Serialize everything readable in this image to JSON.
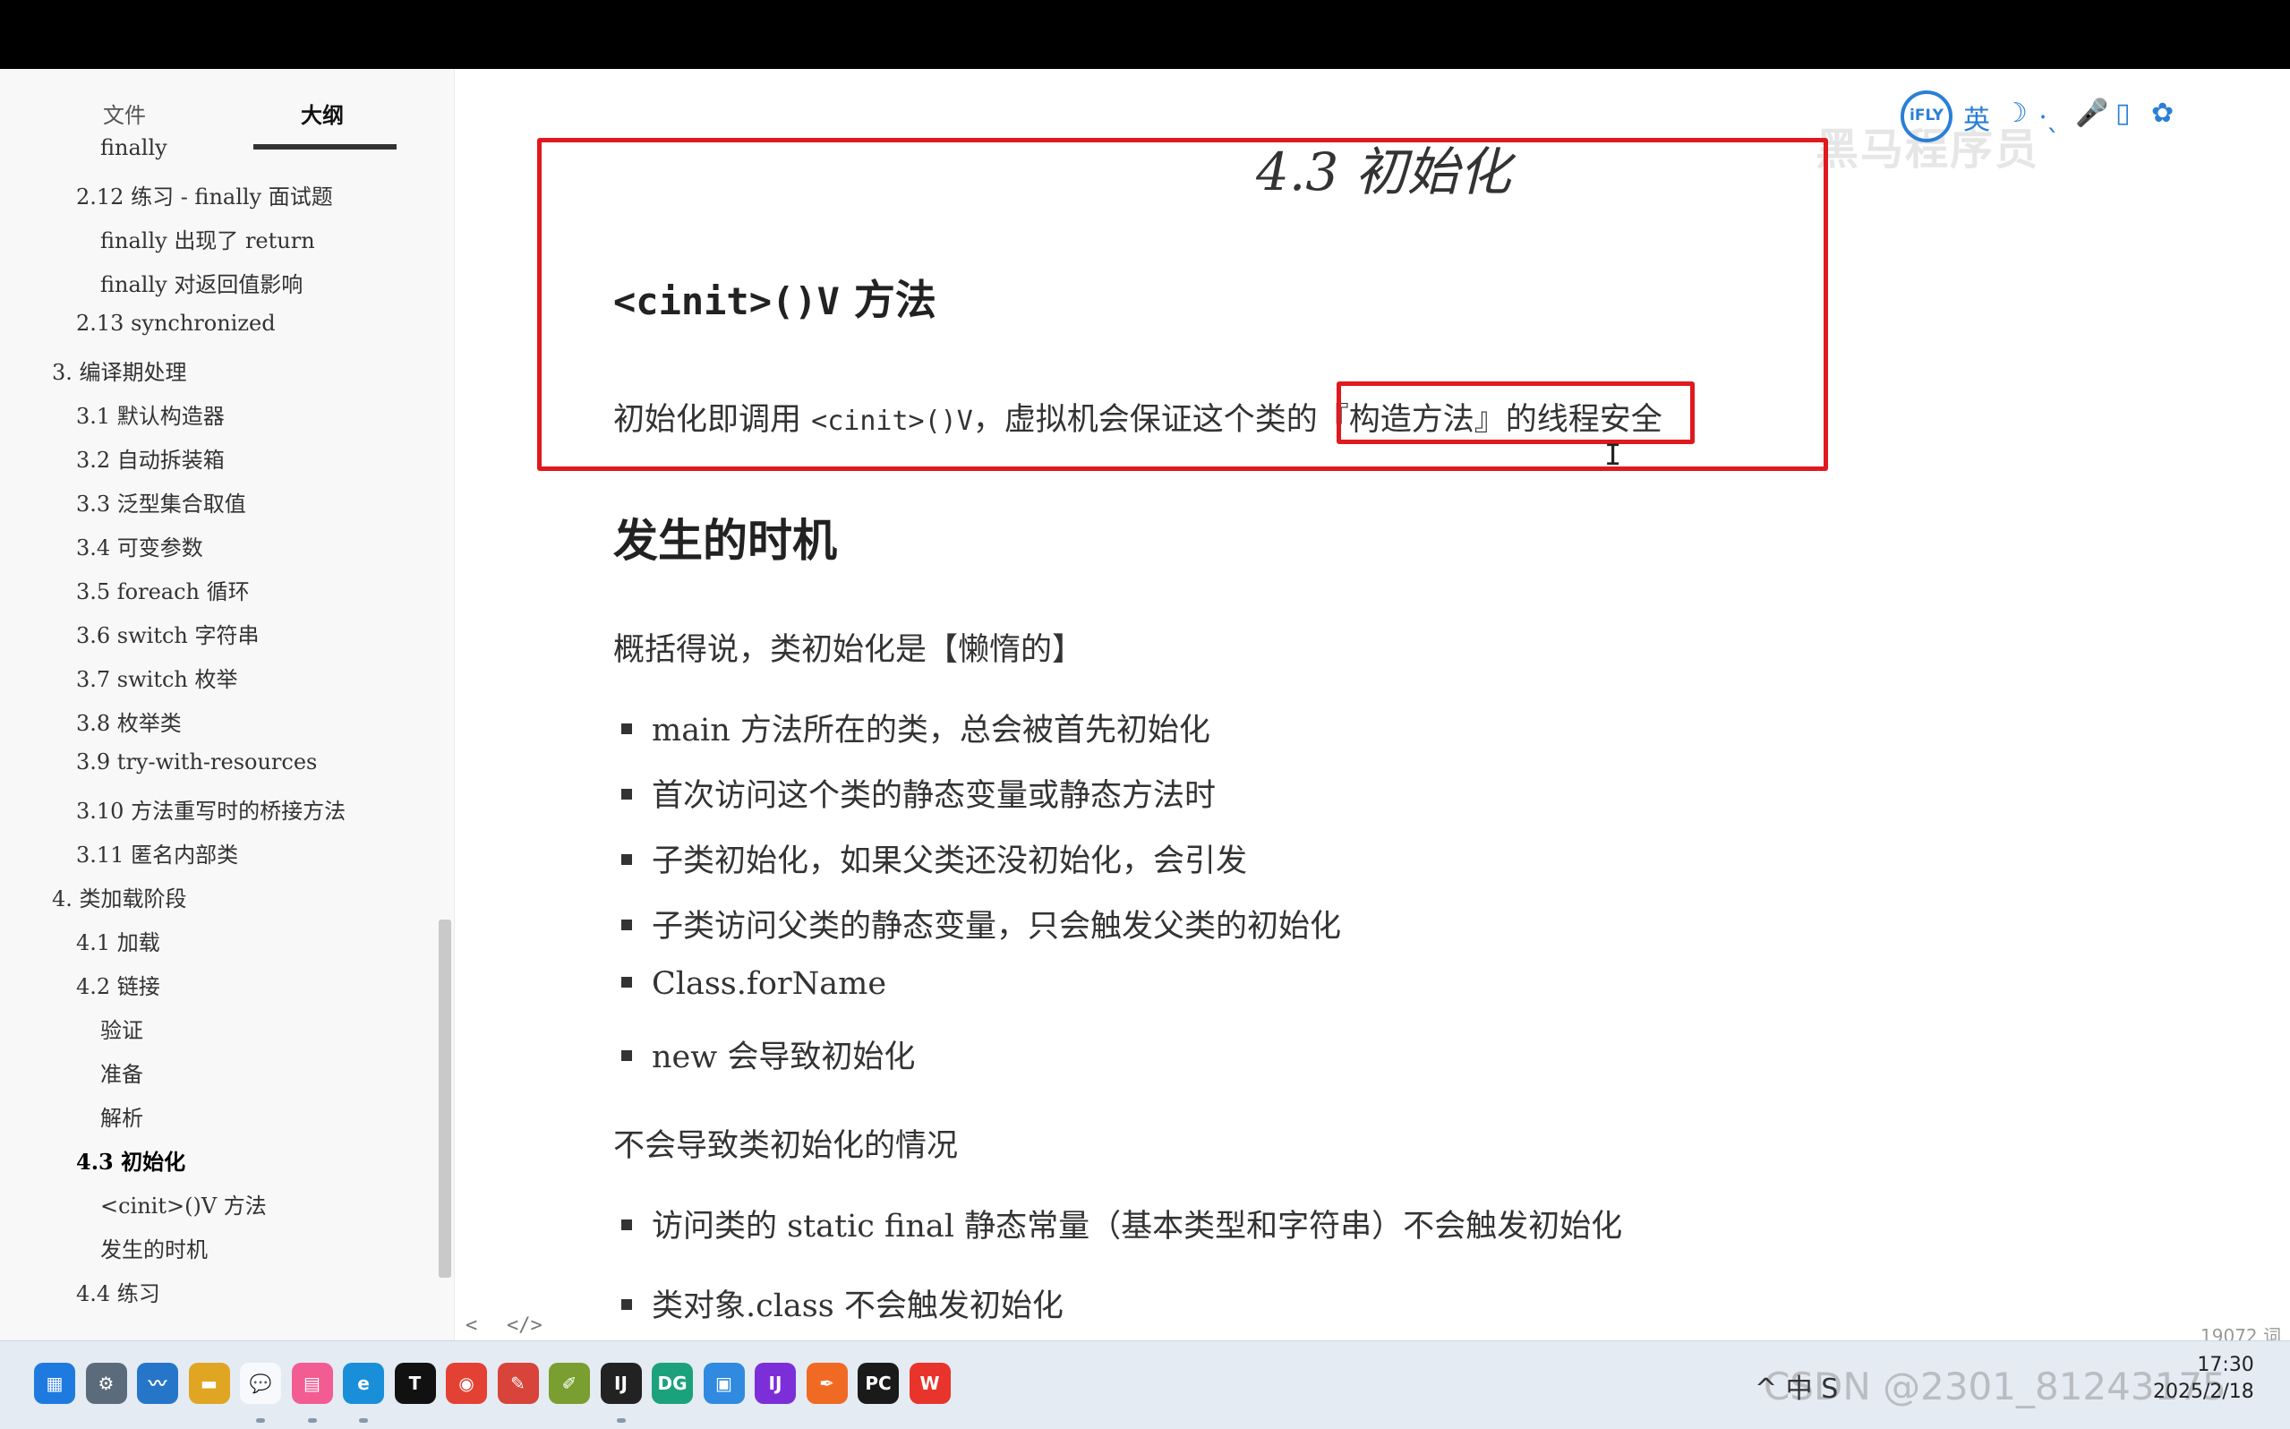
{
  "sidebar": {
    "tabs": {
      "file": "文件",
      "outline": "大纲"
    },
    "items": [
      {
        "text": "finally",
        "level": 3
      },
      {
        "text": "2.12 练习 - finally 面试题",
        "level": 2
      },
      {
        "text": "finally 出现了 return",
        "level": 3
      },
      {
        "text": "finally 对返回值影响",
        "level": 3
      },
      {
        "text": "2.13 synchronized",
        "level": 2
      },
      {
        "text": "3. 编译期处理",
        "level": 1
      },
      {
        "text": "3.1 默认构造器",
        "level": 2
      },
      {
        "text": "3.2 自动拆装箱",
        "level": 2
      },
      {
        "text": "3.3 泛型集合取值",
        "level": 2
      },
      {
        "text": "3.4 可变参数",
        "level": 2
      },
      {
        "text": "3.5 foreach 循环",
        "level": 2
      },
      {
        "text": "3.6 switch 字符串",
        "level": 2
      },
      {
        "text": "3.7 switch 枚举",
        "level": 2
      },
      {
        "text": "3.8 枚举类",
        "level": 2
      },
      {
        "text": "3.9 try-with-resources",
        "level": 2
      },
      {
        "text": "3.10 方法重写时的桥接方法",
        "level": 2
      },
      {
        "text": "3.11 匿名内部类",
        "level": 2
      },
      {
        "text": "4. 类加载阶段",
        "level": 1
      },
      {
        "text": "4.1 加载",
        "level": 2
      },
      {
        "text": "4.2 链接",
        "level": 2
      },
      {
        "text": "验证",
        "level": 3
      },
      {
        "text": "准备",
        "level": 3
      },
      {
        "text": "解析",
        "level": 3
      },
      {
        "text": "4.3 初始化",
        "level": 2,
        "active": true
      },
      {
        "text": "<cinit>()V 方法",
        "level": 3
      },
      {
        "text": "发生的时机",
        "level": 3
      },
      {
        "text": "4.4 练习",
        "level": 2
      }
    ]
  },
  "ifly": {
    "logo": "iFLY",
    "icons": [
      "英",
      "☽",
      "⸱ˎ",
      "🎤",
      "▯",
      "✿"
    ]
  },
  "watermark": "黑马程序员",
  "doc": {
    "chapter_title": "4.3 初始化",
    "method_heading_code": "<cinit>()V",
    "method_heading_text": " 方法",
    "para1_a": "初始化即调用 ",
    "para1_code": "<cinit>()V",
    "para1_b": "，虚拟机会保证这个类的『构造方法』的线程安全",
    "timing_heading": "发生的时机",
    "timing_intro": "概括得说，类初始化是【懒惰的】",
    "timing_bullets": [
      "main 方法所在的类，总会被首先初始化",
      "首次访问这个类的静态变量或静态方法时",
      "子类初始化，如果父类还没初始化，会引发",
      "子类访问父类的静态变量，只会触发父类的初始化",
      "Class.forName",
      "new 会导致初始化"
    ],
    "no_init_heading": "不会导致类初始化的情况",
    "no_init_bullets": [
      "访问类的 static final 静态常量（基本类型和字符串）不会触发初始化",
      "类对象.class 不会触发初始化"
    ]
  },
  "statusbar": {
    "back": "<",
    "source": "</>",
    "word_count": "19072 词"
  },
  "taskbar": {
    "apps": [
      "start-icon",
      "settings-icon",
      "photos-icon",
      "file-explorer-icon",
      "wechat-icon",
      "bilibili-icon",
      "edge-icon",
      "typora-icon",
      "chrome-icon",
      "eraser-icon",
      "paint-icon",
      "intellij-icon",
      "datagrip-icon",
      "vmware-icon",
      "intellij-icon-2",
      "pen-icon",
      "pycharm-icon",
      "wps-icon"
    ],
    "tray_text": "^ 中 S",
    "tray_watermark": "CSDN @2301_81243175",
    "time": "17:30",
    "date": "2025/2/18"
  }
}
